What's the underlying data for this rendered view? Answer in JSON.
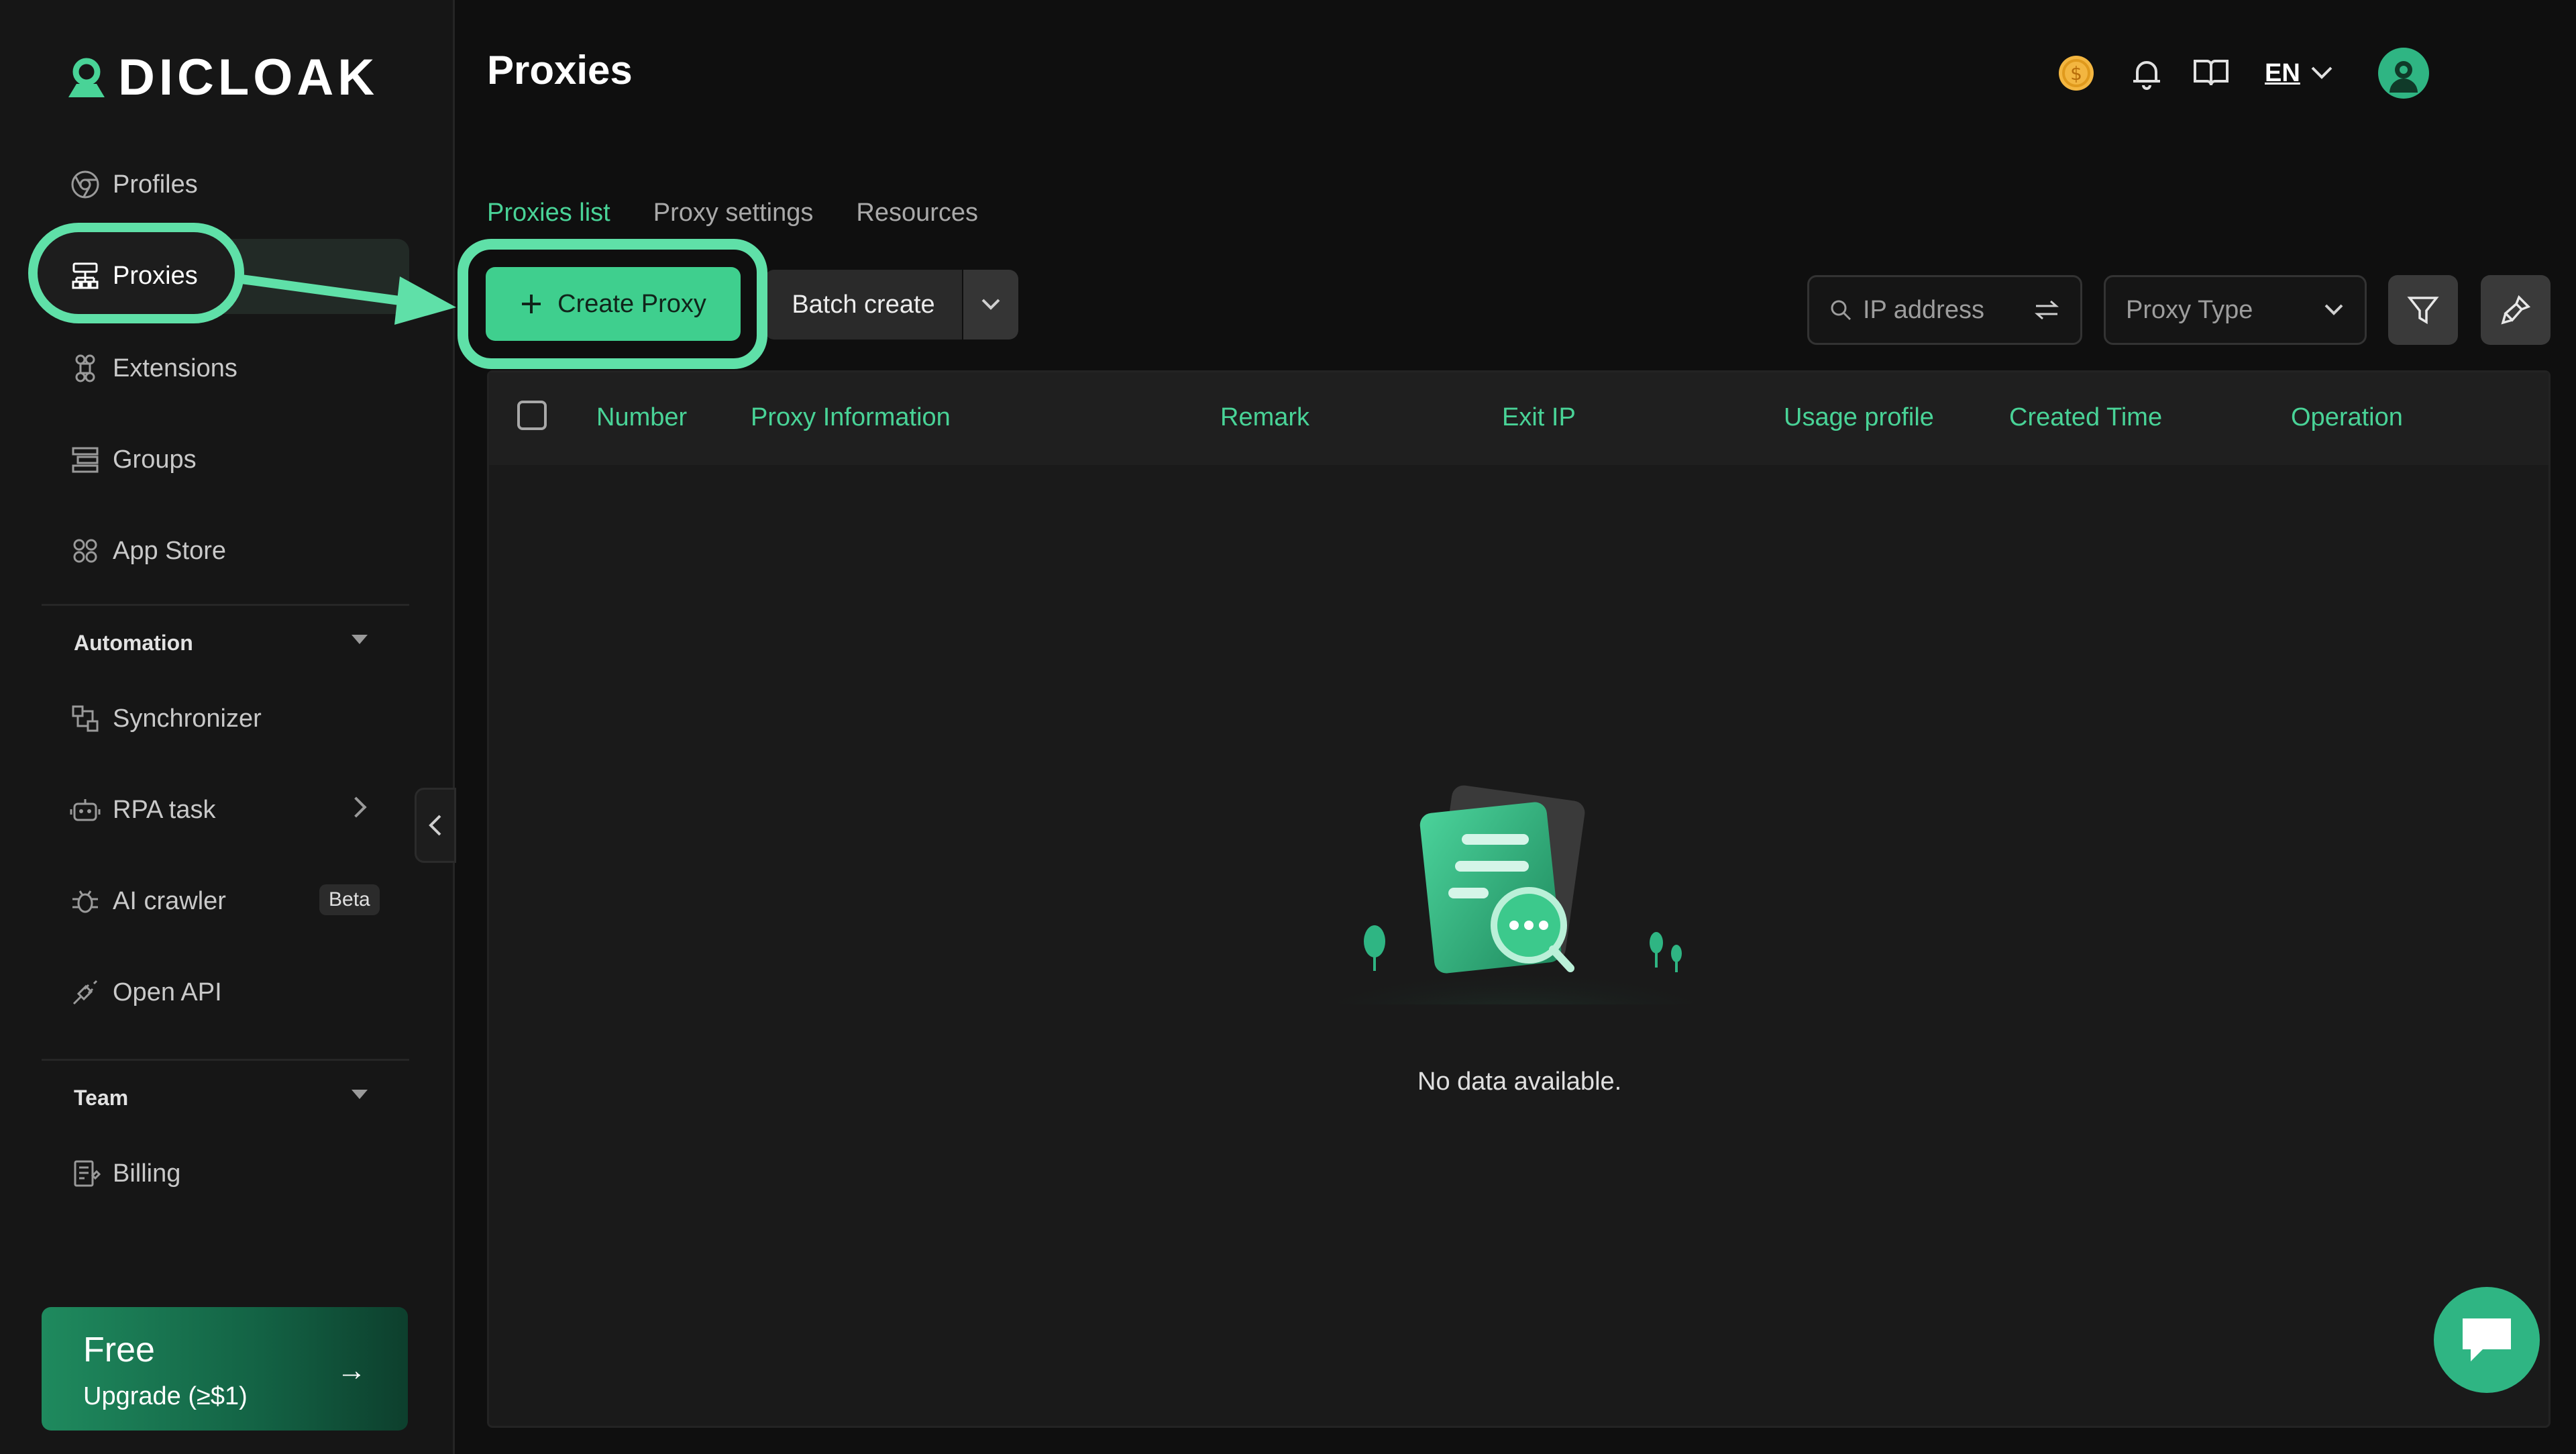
{
  "app": {
    "brand": "DICLOAK",
    "page_title": "Proxies"
  },
  "sidebar": {
    "items": [
      {
        "label": "Profiles",
        "icon": "chrome-icon"
      },
      {
        "label": "Proxies",
        "icon": "network-icon",
        "active": true
      },
      {
        "label": "Extensions",
        "icon": "command-icon"
      },
      {
        "label": "Groups",
        "icon": "groups-icon"
      },
      {
        "label": "App Store",
        "icon": "app-store-icon"
      }
    ],
    "automation": {
      "title": "Automation",
      "items": [
        {
          "label": "Synchronizer",
          "icon": "sync-icon"
        },
        {
          "label": "RPA task",
          "icon": "robot-icon"
        },
        {
          "label": "AI crawler",
          "icon": "bug-icon",
          "badge": "Beta"
        },
        {
          "label": "Open API",
          "icon": "plug-icon"
        }
      ]
    },
    "team": {
      "title": "Team",
      "items": [
        {
          "label": "Billing",
          "icon": "billing-icon"
        }
      ]
    },
    "upgrade": {
      "plan": "Free",
      "label": "Upgrade (≥$1)"
    }
  },
  "header": {
    "language": "EN"
  },
  "tabs": [
    {
      "label": "Proxies list",
      "active": true
    },
    {
      "label": "Proxy settings"
    },
    {
      "label": "Resources"
    }
  ],
  "toolbar": {
    "create_label": "Create Proxy",
    "batch_label": "Batch create",
    "search_placeholder": "IP address",
    "proxy_type_placeholder": "Proxy Type"
  },
  "table": {
    "columns": [
      "Number",
      "Proxy Information",
      "Remark",
      "Exit IP",
      "Usage profile",
      "Created Time",
      "Operation"
    ],
    "empty_text": "No data available."
  },
  "colors": {
    "accent": "#49d397",
    "highlight": "#5fe0a8",
    "button": "#3fcf8e",
    "background": "#0f0f0f"
  }
}
